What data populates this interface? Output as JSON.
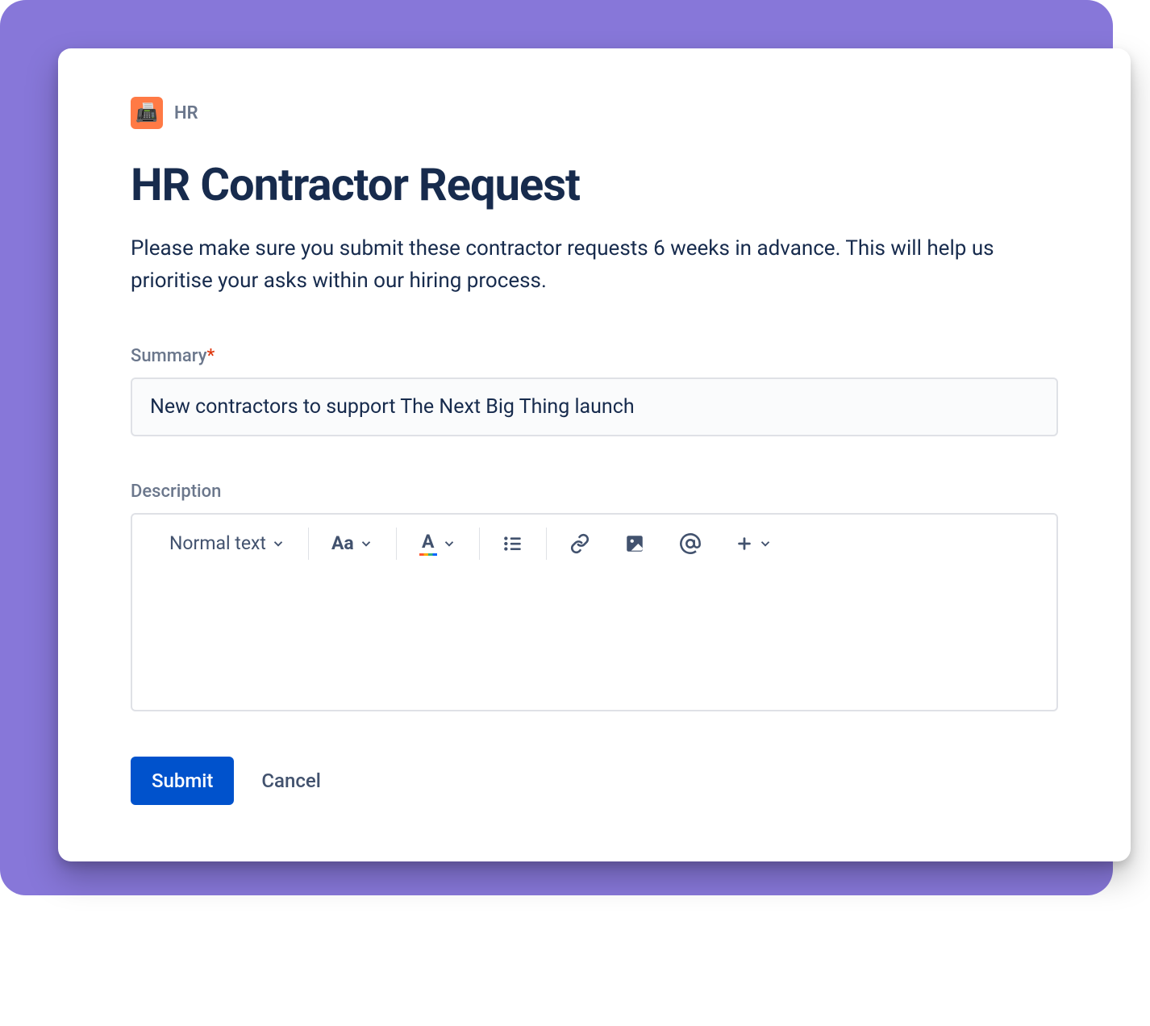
{
  "breadcrumb": {
    "project_label": "HR",
    "project_emoji": "📠"
  },
  "title": "HR Contractor Request",
  "description": "Please make sure you submit these contractor requests 6 weeks in advance. This will help us prioritise your asks within our hiring process.",
  "fields": {
    "summary": {
      "label": "Summary",
      "required_mark": "*",
      "value": "New contractors to support The Next Big Thing launch"
    },
    "description": {
      "label": "Description",
      "value": ""
    }
  },
  "toolbar": {
    "text_style": "Normal text",
    "case_label": "Aa",
    "color_label": "A"
  },
  "actions": {
    "submit": "Submit",
    "cancel": "Cancel"
  }
}
